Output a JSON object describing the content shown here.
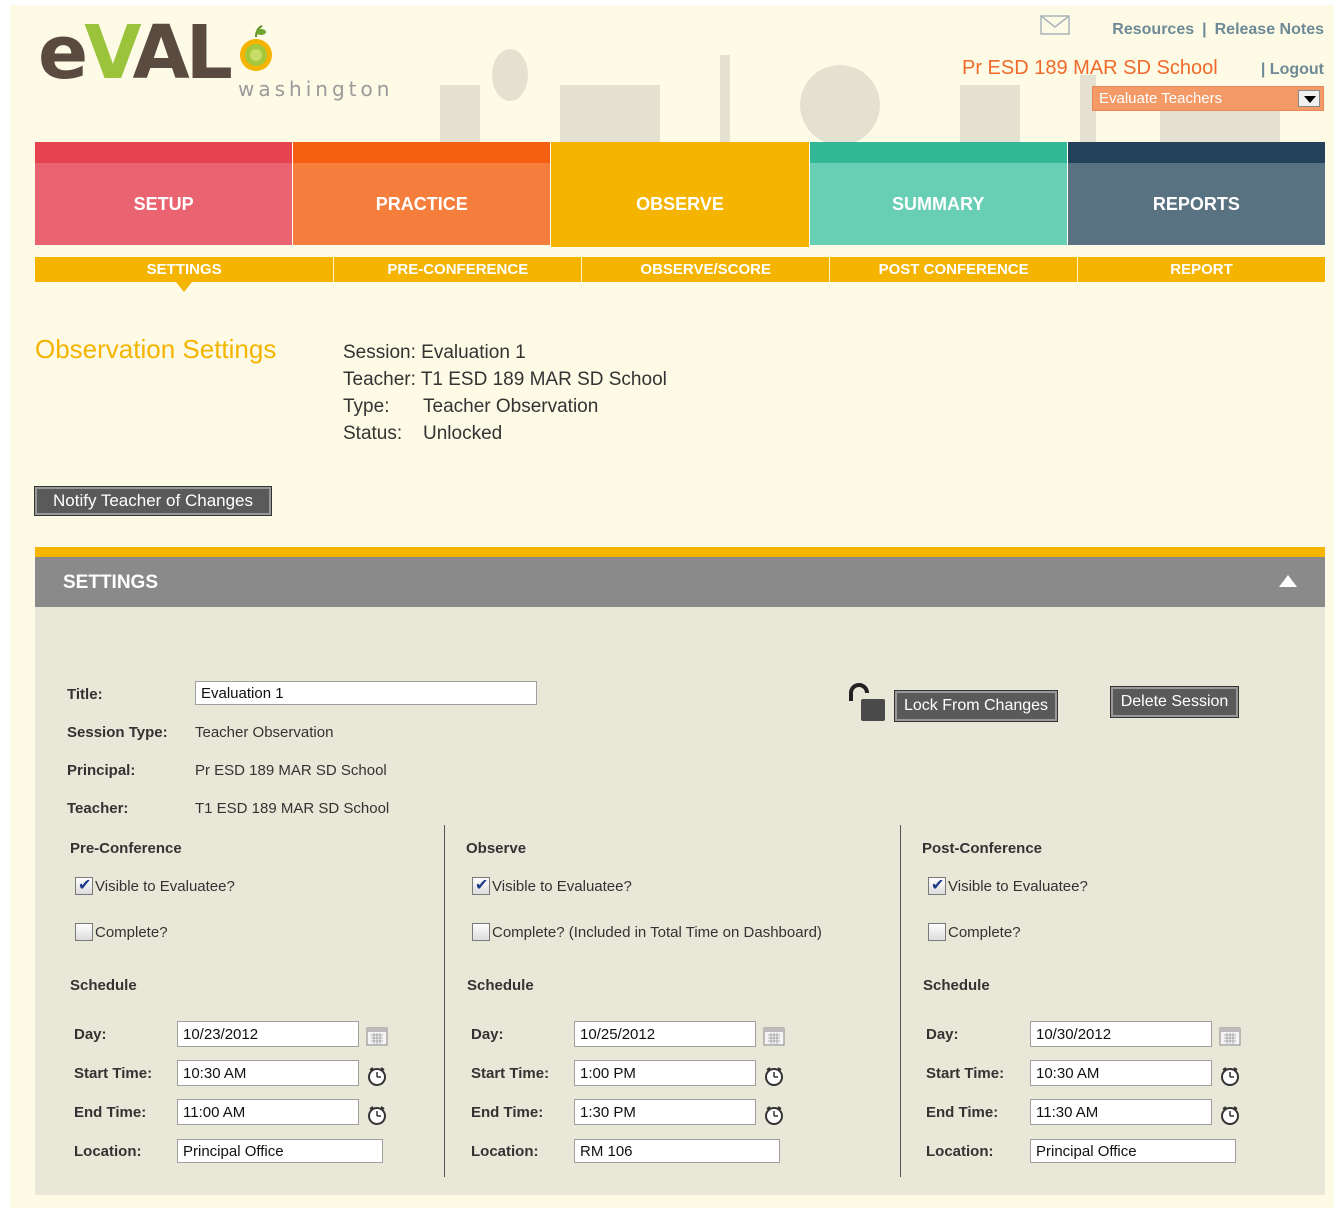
{
  "header": {
    "logo_text_prefix": "e",
    "logo_text_v": "V",
    "logo_text_suffix": "AL",
    "logo_sub": "washington",
    "links": {
      "resources": "Resources",
      "separator": "|",
      "release_notes": "Release Notes",
      "logout": "| Logout"
    },
    "school": "Pr ESD 189 MAR SD School",
    "role_select": "Evaluate Teachers"
  },
  "tabs": [
    {
      "label": "SETUP",
      "cap_color": "#e6424f",
      "body_color": "#ea6370"
    },
    {
      "label": "PRACTICE",
      "cap_color": "#f55f12",
      "body_color": "#f57e3c"
    },
    {
      "label": "OBSERVE",
      "cap_color": "#f4b400",
      "body_color": "#f4b400"
    },
    {
      "label": "SUMMARY",
      "cap_color": "#32b896",
      "body_color": "#68ceb4"
    },
    {
      "label": "REPORTS",
      "cap_color": "#24415a",
      "body_color": "#587282"
    }
  ],
  "subnav": [
    "SETTINGS",
    "PRE-CONFERENCE",
    "OBSERVE/SCORE",
    "POST CONFERENCE",
    "REPORT"
  ],
  "observation": {
    "title": "Observation Settings",
    "session_label": "Session:",
    "session": "Evaluation 1",
    "teacher_label": "Teacher:",
    "teacher": "T1 ESD 189 MAR SD School",
    "type_label": "Type:",
    "type": "Teacher Observation",
    "status_label": "Status:",
    "status": "Unlocked"
  },
  "notify_button": "Notify Teacher of Changes",
  "settings": {
    "header": "SETTINGS",
    "title_label": "Title:",
    "title_value": "Evaluation 1",
    "session_type_label": "Session Type:",
    "session_type": "Teacher Observation",
    "principal_label": "Principal:",
    "principal": "Pr ESD 189 MAR SD School",
    "teacher_label": "Teacher:",
    "teacher": "T1 ESD 189 MAR SD School",
    "lock_button": "Lock From Changes",
    "delete_button": "Delete Session"
  },
  "columns": [
    {
      "heading": "Pre-Conference",
      "visible_label": "Visible to Evaluatee?",
      "visible": true,
      "complete_label": "Complete?",
      "complete": false,
      "schedule_label": "Schedule",
      "day_label": "Day:",
      "day": "10/23/2012",
      "start_label": "Start Time:",
      "start": "10:30 AM",
      "end_label": "End Time:",
      "end": "11:00 AM",
      "location_label": "Location:",
      "location": "Principal Office"
    },
    {
      "heading": "Observe",
      "visible_label": "Visible to Evaluatee?",
      "visible": true,
      "complete_label": "Complete? (Included in Total Time on Dashboard)",
      "complete": false,
      "schedule_label": "Schedule",
      "day_label": "Day:",
      "day": "10/25/2012",
      "start_label": "Start Time:",
      "start": "1:00 PM",
      "end_label": "End Time:",
      "end": "1:30 PM",
      "location_label": "Location:",
      "location": "RM 106"
    },
    {
      "heading": "Post-Conference",
      "visible_label": "Visible to Evaluatee?",
      "visible": true,
      "complete_label": "Complete?",
      "complete": false,
      "schedule_label": "Schedule",
      "day_label": "Day:",
      "day": "10/30/2012",
      "start_label": "Start Time:",
      "start": "10:30 AM",
      "end_label": "End Time:",
      "end": "11:30 AM",
      "location_label": "Location:",
      "location": "Principal Office"
    }
  ],
  "colors": {
    "accent": "#f4b400",
    "school": "#f06a2a",
    "link": "#6d8a96",
    "panel": "#e9e7d7"
  }
}
